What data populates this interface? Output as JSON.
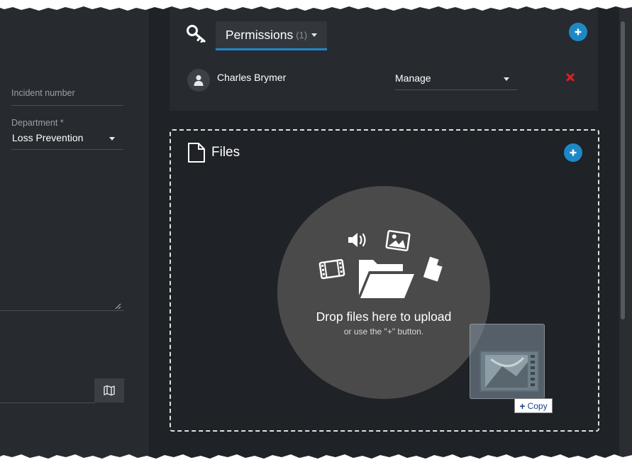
{
  "left_panel": {
    "incident_label": "Incident number",
    "department_label": "Department *",
    "department_value": "Loss Prevention",
    "map_icon": "map-icon"
  },
  "permissions": {
    "title": "Permissions",
    "count": "(1)",
    "icon": "key-icon",
    "users": [
      {
        "name": "Charles Brymer",
        "role": "Manage"
      }
    ]
  },
  "files": {
    "title": "Files",
    "drop_title": "Drop files here to upload",
    "drop_subtitle": "or use the \"+\" button.",
    "icons": [
      "film-icon",
      "speaker-icon",
      "picture-icon",
      "folder-open-icon",
      "document-icon"
    ]
  },
  "drag": {
    "copy_label": "Copy"
  },
  "colors": {
    "accent": "#1e88c7",
    "background": "#1f2226",
    "panel": "#272b30",
    "remove": "#e02020"
  }
}
